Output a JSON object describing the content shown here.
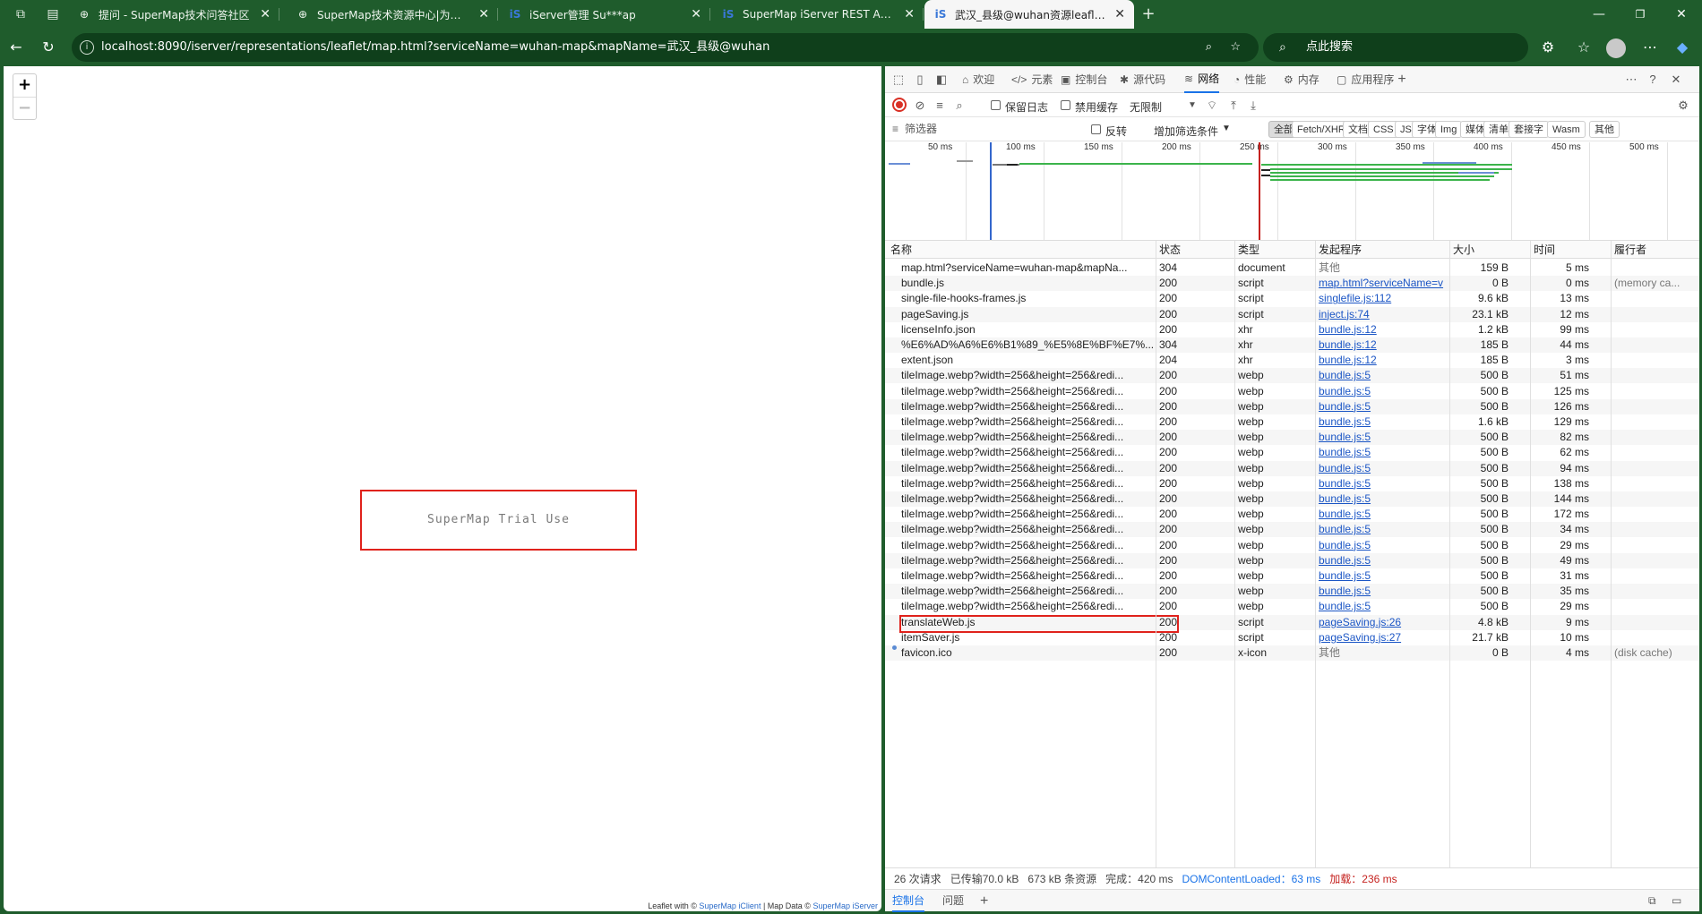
{
  "browser": {
    "tabs": [
      {
        "title": "提问 - SuperMap技术问答社区",
        "icon": "globe-icon"
      },
      {
        "title": "SuperMap技术资源中心|为您提供",
        "icon": "globe-icon"
      },
      {
        "title": "iServer管理 Su***ap",
        "icon": "iserver-logo-icon"
      },
      {
        "title": "SuperMap iServer REST API Su***",
        "icon": "iserver-logo-icon"
      },
      {
        "title": "武汉_县级@wuhan资源leaflet表述",
        "icon": "iserver-logo-icon",
        "active": true
      }
    ],
    "address": "localhost:8090/iserver/representations/leaflet/map.html?serviceName=wuhan-map&mapName=武汉_县级@wuhan",
    "search_placeholder": "点此搜索"
  },
  "map": {
    "zoom_in": "+",
    "zoom_out": "−",
    "trial_text": "SuperMap Trial Use",
    "attribution": {
      "prefix": "Leaflet with © ",
      "iclient": "SuperMap iClient",
      "middle": " | Map Data © ",
      "iserver": "SuperMap iServer"
    }
  },
  "devtools": {
    "tabs": [
      {
        "label": "欢迎",
        "icon": "home-icon"
      },
      {
        "label": "元素",
        "icon": "code-icon"
      },
      {
        "label": "控制台",
        "icon": "console-icon"
      },
      {
        "label": "源代码",
        "icon": "bug-icon"
      },
      {
        "label": "网络",
        "icon": "wifi-icon",
        "active": true
      },
      {
        "label": "性能",
        "icon": "performance-icon"
      },
      {
        "label": "内存",
        "icon": "memory-icon"
      },
      {
        "label": "应用程序",
        "icon": "application-icon"
      }
    ],
    "toolbar": {
      "preserve_log": "保留日志",
      "disable_cache": "禁用缓存",
      "throttling": "无限制"
    },
    "filter": {
      "placeholder": "筛选器",
      "invert": "反转",
      "more_filters": "增加筛选条件",
      "types": [
        "全部",
        "Fetch/XHR",
        "文档",
        "CSS",
        "JS",
        "字体",
        "Img",
        "媒体",
        "清单",
        "套接字",
        "Wasm",
        "其他"
      ]
    },
    "timeline_ticks": [
      "50 ms",
      "100 ms",
      "150 ms",
      "200 ms",
      "250 ms",
      "300 ms",
      "350 ms",
      "400 ms",
      "450 ms",
      "500 ms"
    ],
    "columns": [
      "名称",
      "状态",
      "类型",
      "发起程序",
      "大小",
      "时间",
      "履行者"
    ],
    "rows": [
      {
        "name": "map.html?serviceName=wuhan-map&mapNa...",
        "status": "304",
        "type": "document",
        "initiator": "其他",
        "size": "159 B",
        "time": "5 ms",
        "fulfilled": ""
      },
      {
        "name": "bundle.js",
        "status": "200",
        "type": "script",
        "initiator": "map.html?serviceName=v",
        "size": "0 B",
        "time": "0 ms",
        "fulfilled": "(memory ca..."
      },
      {
        "name": "single-file-hooks-frames.js",
        "status": "200",
        "type": "script",
        "initiator": "singlefile.js:112",
        "size": "9.6 kB",
        "time": "13 ms",
        "fulfilled": ""
      },
      {
        "name": "pageSaving.js",
        "status": "200",
        "type": "script",
        "initiator": "inject.js:74",
        "size": "23.1 kB",
        "time": "12 ms",
        "fulfilled": ""
      },
      {
        "name": "licenseInfo.json",
        "status": "200",
        "type": "xhr",
        "initiator": "bundle.js:12",
        "size": "1.2 kB",
        "time": "99 ms",
        "fulfilled": ""
      },
      {
        "name": "%E6%AD%A6%E6%B1%89_%E5%8E%BF%E7%...",
        "status": "304",
        "type": "xhr",
        "initiator": "bundle.js:12",
        "size": "185 B",
        "time": "44 ms",
        "fulfilled": ""
      },
      {
        "name": "extent.json",
        "status": "204",
        "type": "xhr",
        "initiator": "bundle.js:12",
        "size": "185 B",
        "time": "3 ms",
        "fulfilled": ""
      },
      {
        "name": "tileImage.webp?width=256&height=256&redi...",
        "status": "200",
        "type": "webp",
        "initiator": "bundle.js:5",
        "size": "500 B",
        "time": "51 ms",
        "fulfilled": ""
      },
      {
        "name": "tileImage.webp?width=256&height=256&redi...",
        "status": "200",
        "type": "webp",
        "initiator": "bundle.js:5",
        "size": "500 B",
        "time": "125 ms",
        "fulfilled": ""
      },
      {
        "name": "tileImage.webp?width=256&height=256&redi...",
        "status": "200",
        "type": "webp",
        "initiator": "bundle.js:5",
        "size": "500 B",
        "time": "126 ms",
        "fulfilled": ""
      },
      {
        "name": "tileImage.webp?width=256&height=256&redi...",
        "status": "200",
        "type": "webp",
        "initiator": "bundle.js:5",
        "size": "1.6 kB",
        "time": "129 ms",
        "fulfilled": ""
      },
      {
        "name": "tileImage.webp?width=256&height=256&redi...",
        "status": "200",
        "type": "webp",
        "initiator": "bundle.js:5",
        "size": "500 B",
        "time": "82 ms",
        "fulfilled": ""
      },
      {
        "name": "tileImage.webp?width=256&height=256&redi...",
        "status": "200",
        "type": "webp",
        "initiator": "bundle.js:5",
        "size": "500 B",
        "time": "62 ms",
        "fulfilled": ""
      },
      {
        "name": "tileImage.webp?width=256&height=256&redi...",
        "status": "200",
        "type": "webp",
        "initiator": "bundle.js:5",
        "size": "500 B",
        "time": "94 ms",
        "fulfilled": ""
      },
      {
        "name": "tileImage.webp?width=256&height=256&redi...",
        "status": "200",
        "type": "webp",
        "initiator": "bundle.js:5",
        "size": "500 B",
        "time": "138 ms",
        "fulfilled": ""
      },
      {
        "name": "tileImage.webp?width=256&height=256&redi...",
        "status": "200",
        "type": "webp",
        "initiator": "bundle.js:5",
        "size": "500 B",
        "time": "144 ms",
        "fulfilled": ""
      },
      {
        "name": "tileImage.webp?width=256&height=256&redi...",
        "status": "200",
        "type": "webp",
        "initiator": "bundle.js:5",
        "size": "500 B",
        "time": "172 ms",
        "fulfilled": ""
      },
      {
        "name": "tileImage.webp?width=256&height=256&redi...",
        "status": "200",
        "type": "webp",
        "initiator": "bundle.js:5",
        "size": "500 B",
        "time": "34 ms",
        "fulfilled": ""
      },
      {
        "name": "tileImage.webp?width=256&height=256&redi...",
        "status": "200",
        "type": "webp",
        "initiator": "bundle.js:5",
        "size": "500 B",
        "time": "29 ms",
        "fulfilled": ""
      },
      {
        "name": "tileImage.webp?width=256&height=256&redi...",
        "status": "200",
        "type": "webp",
        "initiator": "bundle.js:5",
        "size": "500 B",
        "time": "49 ms",
        "fulfilled": ""
      },
      {
        "name": "tileImage.webp?width=256&height=256&redi...",
        "status": "200",
        "type": "webp",
        "initiator": "bundle.js:5",
        "size": "500 B",
        "time": "31 ms",
        "fulfilled": ""
      },
      {
        "name": "tileImage.webp?width=256&height=256&redi...",
        "status": "200",
        "type": "webp",
        "initiator": "bundle.js:5",
        "size": "500 B",
        "time": "35 ms",
        "fulfilled": ""
      },
      {
        "name": "tileImage.webp?width=256&height=256&redi...",
        "status": "200",
        "type": "webp",
        "initiator": "bundle.js:5",
        "size": "500 B",
        "time": "29 ms",
        "fulfilled": ""
      },
      {
        "name": "translateWeb.js",
        "status": "200",
        "type": "script",
        "initiator": "pageSaving.js:26",
        "size": "4.8 kB",
        "time": "9 ms",
        "fulfilled": ""
      },
      {
        "name": "itemSaver.js",
        "status": "200",
        "type": "script",
        "initiator": "pageSaving.js:27",
        "size": "21.7 kB",
        "time": "10 ms",
        "fulfilled": ""
      },
      {
        "name": "favicon.ico",
        "status": "200",
        "type": "x-icon",
        "initiator": "其他",
        "size": "0 B",
        "time": "4 ms",
        "fulfilled": "(disk cache)"
      }
    ],
    "summary": {
      "requests": "26 次请求",
      "transferred": "已传输70.0 kB",
      "resources": "673 kB 条资源",
      "finish": "完成：420 ms",
      "dcl": "DOMContentLoaded：63 ms",
      "load": "加载：236 ms"
    },
    "drawer_tabs": [
      "控制台",
      "问题"
    ],
    "colors": {
      "accent": "#1a73e8",
      "highlight": "#e0221c",
      "chrome": "#1f5c2c"
    }
  }
}
